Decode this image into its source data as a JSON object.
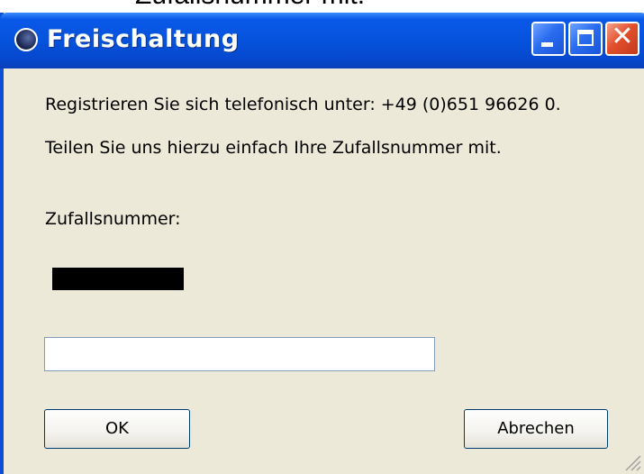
{
  "background": {
    "partial_text": "Zufallsnummer mit."
  },
  "window": {
    "title": "Freischaltung",
    "line1": "Registrieren Sie sich telefonisch unter:  +49 (0)651 96626 0.",
    "line2": "Teilen Sie uns hierzu einfach Ihre Zufallsnummer mit.",
    "random_number_label": "Zufallsnummer:",
    "input": {
      "value": "",
      "placeholder": ""
    },
    "ok_label": "OK",
    "cancel_label": "Abrechen"
  },
  "colors": {
    "titlebar": "#0653dc",
    "window_bg": "#ece9d8",
    "close_button": "#e2502c"
  },
  "icons": [
    "app-icon",
    "minimize-icon",
    "maximize-icon",
    "close-icon",
    "resize-grip-icon"
  ]
}
